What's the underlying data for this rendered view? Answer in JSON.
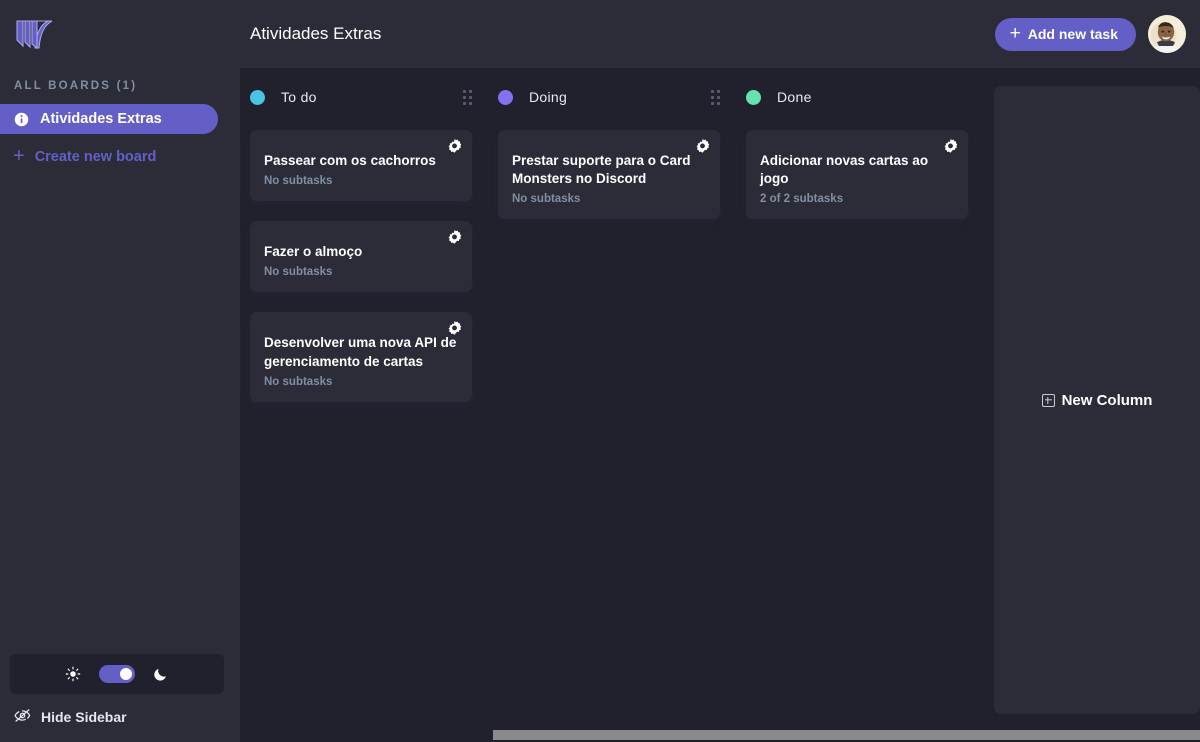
{
  "app": {
    "logo_icon": "kanban-logo-icon",
    "accent_color": "#635fc7",
    "sidebar_bg": "#2b2c37",
    "main_bg": "#20212c"
  },
  "sidebar": {
    "all_boards_label": "ALL BOARDS (1)",
    "boards": [
      {
        "label": "Atividades Extras",
        "icon": "info-circle-icon",
        "active": true
      }
    ],
    "create_board_label": "Create new board",
    "create_board_icon": "plus-icon",
    "theme_toggle": {
      "light_icon": "sun-icon",
      "dark_icon": "moon-icon",
      "state": "dark"
    },
    "hide_sidebar_label": "Hide Sidebar",
    "hide_sidebar_icon": "eye-slash-icon"
  },
  "topbar": {
    "board_title": "Atividades Extras",
    "add_task_label": "Add new task",
    "add_task_icon": "plus-icon",
    "avatar_icon": "user-avatar"
  },
  "board": {
    "new_column_label": "New Column",
    "new_column_icon": "boxed-plus-icon",
    "columns": [
      {
        "name": "To do",
        "dot_color": "#49c4e5",
        "has_drag_handle": true,
        "drag_icon": "drag-handle-icon",
        "cards": [
          {
            "title": "Passear com os cachorros",
            "subtasks": "No subtasks",
            "settings_icon": "gear-icon"
          },
          {
            "title": "Fazer o almoço",
            "subtasks": "No subtasks",
            "settings_icon": "gear-icon"
          },
          {
            "title": "Desenvolver uma nova API de gerenciamento de cartas",
            "subtasks": "No subtasks",
            "settings_icon": "gear-icon"
          }
        ]
      },
      {
        "name": "Doing",
        "dot_color": "#8471f2",
        "has_drag_handle": true,
        "drag_icon": "drag-handle-icon",
        "cards": [
          {
            "title": "Prestar suporte para o Card Monsters no Discord",
            "subtasks": "No subtasks",
            "settings_icon": "gear-icon"
          }
        ]
      },
      {
        "name": "Done",
        "dot_color": "#67e2ae",
        "has_drag_handle": false,
        "drag_icon": "drag-handle-icon",
        "cards": [
          {
            "title": "Adicionar novas cartas ao jogo",
            "subtasks": "2 of 2 subtasks",
            "settings_icon": "gear-icon"
          }
        ]
      }
    ]
  },
  "scrollbar": {
    "orientation": "horizontal",
    "icon": "horizontal-scrollbar"
  }
}
